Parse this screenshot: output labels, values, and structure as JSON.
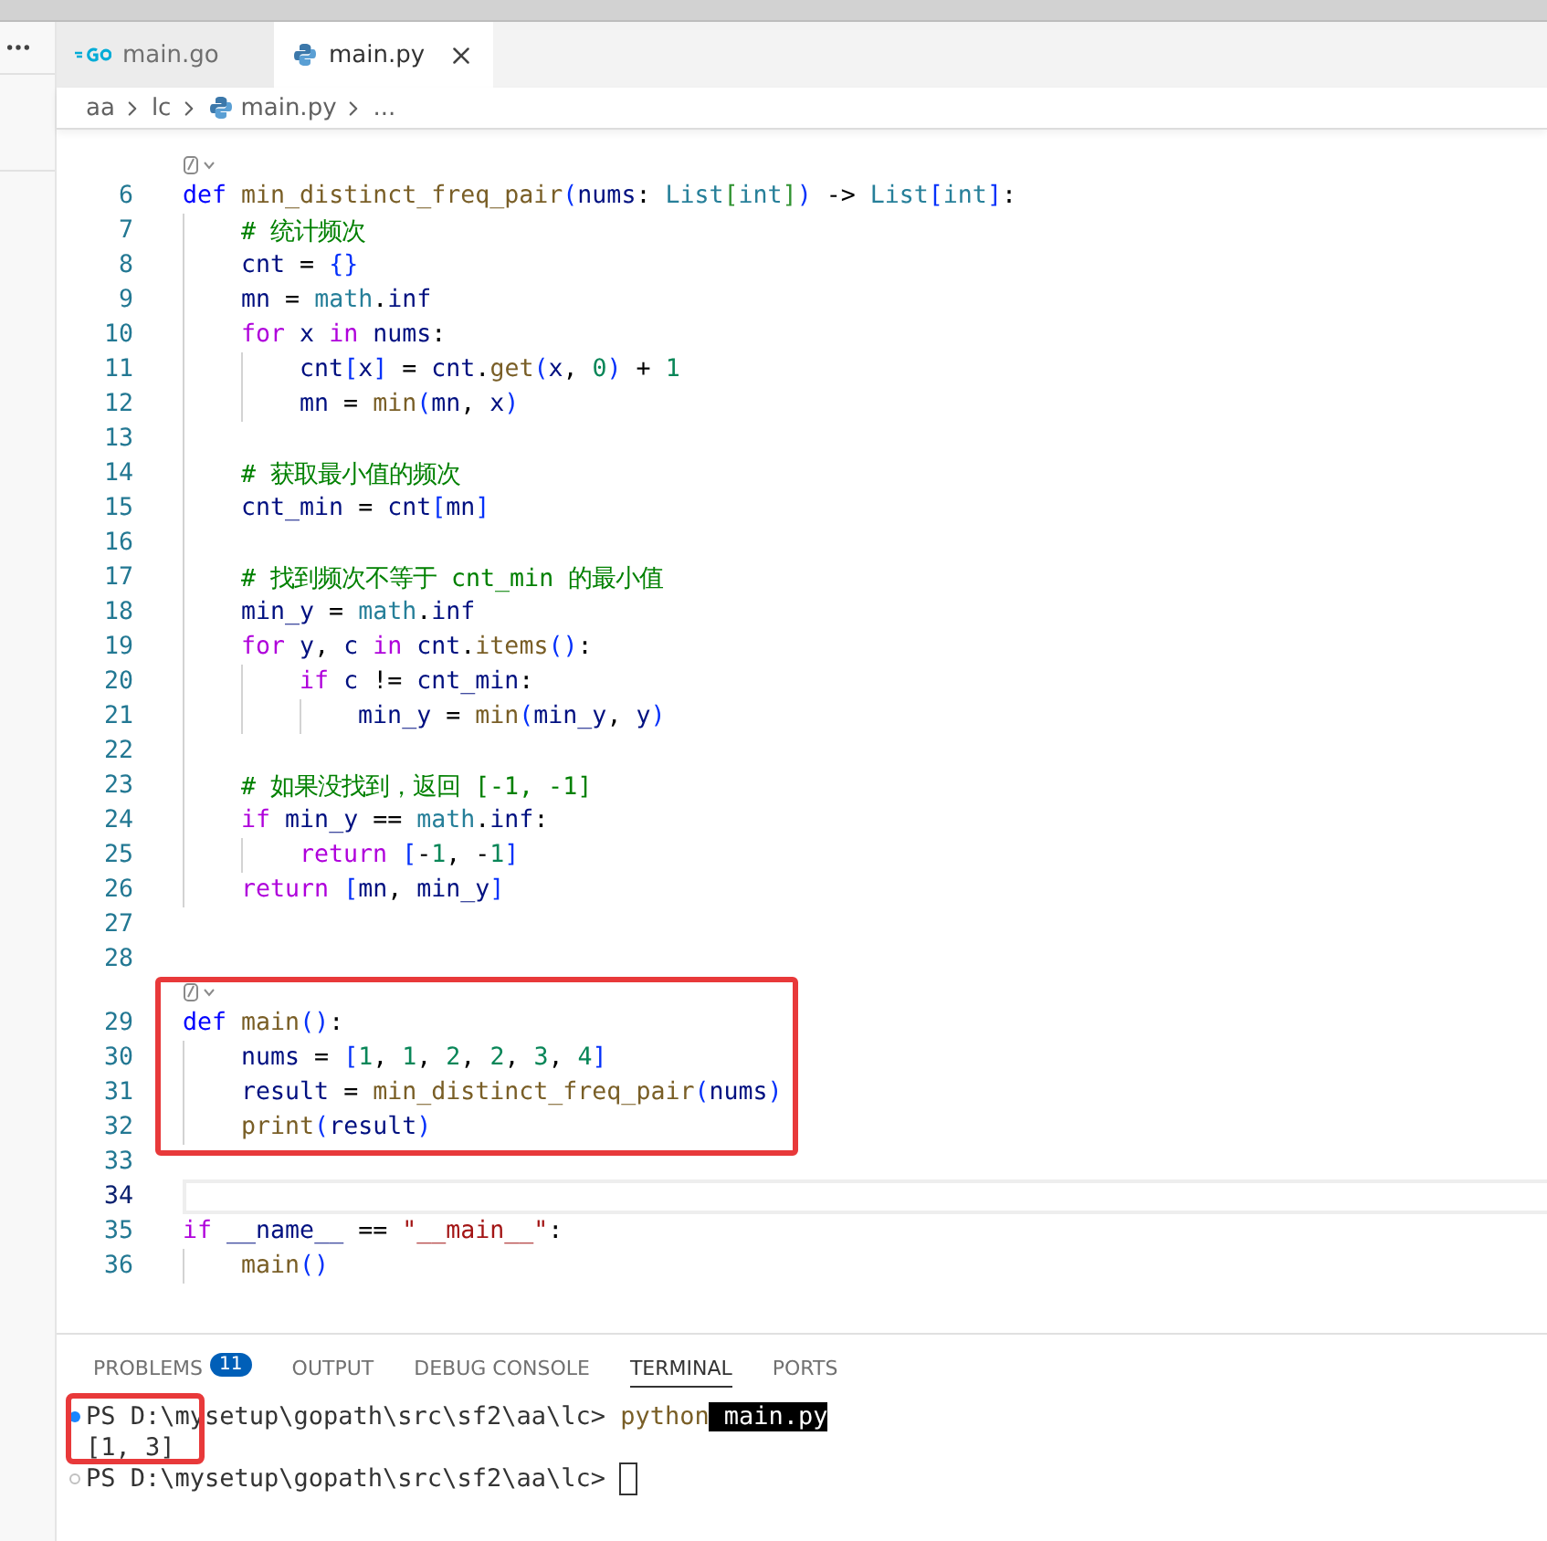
{
  "editor_tabs": [
    {
      "label": "main.go",
      "selected": false
    },
    {
      "label": "main.py",
      "selected": true
    }
  ],
  "breadcrumb": [
    "aa",
    "lc",
    "main.py",
    "..."
  ],
  "code": {
    "blocks": [
      {
        "marked": false,
        "lens": true,
        "lines": [
          {
            "number": "6",
            "tokens": [
              {
                "kind": "keyword",
                "text": "def "
              },
              {
                "kind": "function",
                "text": "min_distinct_freq_pair"
              },
              {
                "kind": "bracket",
                "text": "("
              },
              {
                "kind": "variable",
                "text": "nums"
              },
              {
                "kind": "punct",
                "text": ": "
              },
              {
                "kind": "type",
                "text": "List"
              },
              {
                "kind": "bracket2",
                "text": "["
              },
              {
                "kind": "type",
                "text": "int"
              },
              {
                "kind": "bracket2",
                "text": "]"
              },
              {
                "kind": "bracket",
                "text": ")"
              },
              {
                "kind": "punct",
                "text": " -> "
              },
              {
                "kind": "type",
                "text": "List"
              },
              {
                "kind": "bracket",
                "text": "["
              },
              {
                "kind": "type",
                "text": "int"
              },
              {
                "kind": "bracket",
                "text": "]"
              },
              {
                "kind": "punct",
                "text": ":"
              }
            ],
            "children": [
              {
                "number": "7",
                "tokens": [
                  {
                    "kind": "comment",
                    "text": "# 统计频次"
                  }
                ]
              },
              {
                "number": "8",
                "tokens": [
                  {
                    "kind": "variable",
                    "text": "cnt"
                  },
                  {
                    "kind": "punct",
                    "text": " = "
                  },
                  {
                    "kind": "bracket",
                    "text": "{}"
                  }
                ]
              },
              {
                "number": "9",
                "tokens": [
                  {
                    "kind": "variable",
                    "text": "mn"
                  },
                  {
                    "kind": "punct",
                    "text": " = "
                  },
                  {
                    "kind": "type",
                    "text": "math"
                  },
                  {
                    "kind": "punct",
                    "text": "."
                  },
                  {
                    "kind": "variable",
                    "text": "inf"
                  }
                ]
              },
              {
                "number": "10",
                "tokens": [
                  {
                    "kind": "control",
                    "text": "for "
                  },
                  {
                    "kind": "variable",
                    "text": "x "
                  },
                  {
                    "kind": "control",
                    "text": "in "
                  },
                  {
                    "kind": "variable",
                    "text": "nums"
                  },
                  {
                    "kind": "punct",
                    "text": ":"
                  }
                ],
                "children": [
                  {
                    "number": "11",
                    "tokens": [
                      {
                        "kind": "variable",
                        "text": "cnt"
                      },
                      {
                        "kind": "bracket",
                        "text": "["
                      },
                      {
                        "kind": "variable",
                        "text": "x"
                      },
                      {
                        "kind": "bracket",
                        "text": "]"
                      },
                      {
                        "kind": "punct",
                        "text": " = "
                      },
                      {
                        "kind": "variable",
                        "text": "cnt"
                      },
                      {
                        "kind": "punct",
                        "text": "."
                      },
                      {
                        "kind": "function",
                        "text": "get"
                      },
                      {
                        "kind": "bracket",
                        "text": "("
                      },
                      {
                        "kind": "variable",
                        "text": "x"
                      },
                      {
                        "kind": "punct",
                        "text": ", "
                      },
                      {
                        "kind": "number",
                        "text": "0"
                      },
                      {
                        "kind": "bracket",
                        "text": ")"
                      },
                      {
                        "kind": "punct",
                        "text": " + "
                      },
                      {
                        "kind": "number",
                        "text": "1"
                      }
                    ]
                  },
                  {
                    "number": "12",
                    "tokens": [
                      {
                        "kind": "variable",
                        "text": "mn"
                      },
                      {
                        "kind": "punct",
                        "text": " = "
                      },
                      {
                        "kind": "function",
                        "text": "min"
                      },
                      {
                        "kind": "bracket",
                        "text": "("
                      },
                      {
                        "kind": "variable",
                        "text": "mn"
                      },
                      {
                        "kind": "punct",
                        "text": ", "
                      },
                      {
                        "kind": "variable",
                        "text": "x"
                      },
                      {
                        "kind": "bracket",
                        "text": ")"
                      }
                    ]
                  }
                ]
              },
              {
                "number": "13"
              },
              {
                "number": "14",
                "tokens": [
                  {
                    "kind": "comment",
                    "text": "# 获取最小值的频次"
                  }
                ]
              },
              {
                "number": "15",
                "tokens": [
                  {
                    "kind": "variable",
                    "text": "cnt_min"
                  },
                  {
                    "kind": "punct",
                    "text": " = "
                  },
                  {
                    "kind": "variable",
                    "text": "cnt"
                  },
                  {
                    "kind": "bracket",
                    "text": "["
                  },
                  {
                    "kind": "variable",
                    "text": "mn"
                  },
                  {
                    "kind": "bracket",
                    "text": "]"
                  }
                ]
              },
              {
                "number": "16"
              },
              {
                "number": "17",
                "tokens": [
                  {
                    "kind": "comment",
                    "text": "# 找到频次不等于 cnt_min 的最小值"
                  }
                ]
              },
              {
                "number": "18",
                "tokens": [
                  {
                    "kind": "variable",
                    "text": "min_y"
                  },
                  {
                    "kind": "punct",
                    "text": " = "
                  },
                  {
                    "kind": "type",
                    "text": "math"
                  },
                  {
                    "kind": "punct",
                    "text": "."
                  },
                  {
                    "kind": "variable",
                    "text": "inf"
                  }
                ]
              },
              {
                "number": "19",
                "tokens": [
                  {
                    "kind": "control",
                    "text": "for "
                  },
                  {
                    "kind": "variable",
                    "text": "y"
                  },
                  {
                    "kind": "punct",
                    "text": ", "
                  },
                  {
                    "kind": "variable",
                    "text": "c "
                  },
                  {
                    "kind": "control",
                    "text": "in "
                  },
                  {
                    "kind": "variable",
                    "text": "cnt"
                  },
                  {
                    "kind": "punct",
                    "text": "."
                  },
                  {
                    "kind": "function",
                    "text": "items"
                  },
                  {
                    "kind": "bracket",
                    "text": "()"
                  },
                  {
                    "kind": "punct",
                    "text": ":"
                  }
                ],
                "children": [
                  {
                    "number": "20",
                    "tokens": [
                      {
                        "kind": "control",
                        "text": "if "
                      },
                      {
                        "kind": "variable",
                        "text": "c"
                      },
                      {
                        "kind": "punct",
                        "text": " != "
                      },
                      {
                        "kind": "variable",
                        "text": "cnt_min"
                      },
                      {
                        "kind": "punct",
                        "text": ":"
                      }
                    ],
                    "children": [
                      {
                        "number": "21",
                        "tokens": [
                          {
                            "kind": "variable",
                            "text": "min_y"
                          },
                          {
                            "kind": "punct",
                            "text": " = "
                          },
                          {
                            "kind": "function",
                            "text": "min"
                          },
                          {
                            "kind": "bracket",
                            "text": "("
                          },
                          {
                            "kind": "variable",
                            "text": "min_y"
                          },
                          {
                            "kind": "punct",
                            "text": ", "
                          },
                          {
                            "kind": "variable",
                            "text": "y"
                          },
                          {
                            "kind": "bracket",
                            "text": ")"
                          }
                        ]
                      }
                    ]
                  }
                ]
              },
              {
                "number": "22"
              },
              {
                "number": "23",
                "tokens": [
                  {
                    "kind": "comment",
                    "text": "# 如果没找到，返回 [-1, -1]"
                  }
                ]
              },
              {
                "number": "24",
                "tokens": [
                  {
                    "kind": "control",
                    "text": "if "
                  },
                  {
                    "kind": "variable",
                    "text": "min_y"
                  },
                  {
                    "kind": "punct",
                    "text": " == "
                  },
                  {
                    "kind": "type",
                    "text": "math"
                  },
                  {
                    "kind": "punct",
                    "text": "."
                  },
                  {
                    "kind": "variable",
                    "text": "inf"
                  },
                  {
                    "kind": "punct",
                    "text": ":"
                  }
                ],
                "children": [
                  {
                    "number": "25",
                    "tokens": [
                      {
                        "kind": "control",
                        "text": "return "
                      },
                      {
                        "kind": "bracket",
                        "text": "["
                      },
                      {
                        "kind": "punct",
                        "text": "-"
                      },
                      {
                        "kind": "number",
                        "text": "1"
                      },
                      {
                        "kind": "punct",
                        "text": ", -"
                      },
                      {
                        "kind": "number",
                        "text": "1"
                      },
                      {
                        "kind": "bracket",
                        "text": "]"
                      }
                    ]
                  }
                ]
              },
              {
                "number": "26",
                "tokens": [
                  {
                    "kind": "control",
                    "text": "return "
                  },
                  {
                    "kind": "bracket",
                    "text": "["
                  },
                  {
                    "kind": "variable",
                    "text": "mn"
                  },
                  {
                    "kind": "punct",
                    "text": ", "
                  },
                  {
                    "kind": "variable",
                    "text": "min_y"
                  },
                  {
                    "kind": "bracket",
                    "text": "]"
                  }
                ]
              }
            ]
          },
          {
            "number": "27"
          },
          {
            "number": "28"
          }
        ]
      },
      {
        "marked": true,
        "lens": true,
        "lines": [
          {
            "number": "29",
            "tokens": [
              {
                "kind": "keyword",
                "text": "def "
              },
              {
                "kind": "function",
                "text": "main"
              },
              {
                "kind": "bracket",
                "text": "()"
              },
              {
                "kind": "punct",
                "text": ":"
              }
            ],
            "children": [
              {
                "number": "30",
                "tokens": [
                  {
                    "kind": "variable",
                    "text": "nums"
                  },
                  {
                    "kind": "punct",
                    "text": " = "
                  },
                  {
                    "kind": "bracket",
                    "text": "["
                  },
                  {
                    "kind": "number",
                    "text": "1"
                  },
                  {
                    "kind": "punct",
                    "text": ", "
                  },
                  {
                    "kind": "number",
                    "text": "1"
                  },
                  {
                    "kind": "punct",
                    "text": ", "
                  },
                  {
                    "kind": "number",
                    "text": "2"
                  },
                  {
                    "kind": "punct",
                    "text": ", "
                  },
                  {
                    "kind": "number",
                    "text": "2"
                  },
                  {
                    "kind": "punct",
                    "text": ", "
                  },
                  {
                    "kind": "number",
                    "text": "3"
                  },
                  {
                    "kind": "punct",
                    "text": ", "
                  },
                  {
                    "kind": "number",
                    "text": "4"
                  },
                  {
                    "kind": "bracket",
                    "text": "]"
                  }
                ]
              },
              {
                "number": "31",
                "tokens": [
                  {
                    "kind": "variable",
                    "text": "result"
                  },
                  {
                    "kind": "punct",
                    "text": " = "
                  },
                  {
                    "kind": "function",
                    "text": "min_distinct_freq_pair"
                  },
                  {
                    "kind": "bracket",
                    "text": "("
                  },
                  {
                    "kind": "variable",
                    "text": "nums"
                  },
                  {
                    "kind": "bracket",
                    "text": ")"
                  }
                ]
              },
              {
                "number": "32",
                "tokens": [
                  {
                    "kind": "function",
                    "text": "print"
                  },
                  {
                    "kind": "bracket",
                    "text": "("
                  },
                  {
                    "kind": "variable",
                    "text": "result"
                  },
                  {
                    "kind": "bracket",
                    "text": ")"
                  }
                ]
              }
            ]
          },
          {
            "number": "33"
          }
        ]
      },
      {
        "marked": false,
        "lens": false,
        "lines": [
          {
            "number": "34",
            "current": true
          },
          {
            "number": "35",
            "tokens": [
              {
                "kind": "control",
                "text": "if "
              },
              {
                "kind": "variable",
                "text": "__name__"
              },
              {
                "kind": "punct",
                "text": " == "
              },
              {
                "kind": "string",
                "text": "\"__main__\""
              },
              {
                "kind": "punct",
                "text": ":"
              }
            ],
            "children": [
              {
                "number": "36",
                "tokens": [
                  {
                    "kind": "function",
                    "text": "main"
                  },
                  {
                    "kind": "bracket",
                    "text": "()"
                  }
                ]
              }
            ]
          }
        ]
      }
    ]
  },
  "panel_tabs": [
    {
      "label": "PROBLEMS",
      "badge": "11",
      "selected": false
    },
    {
      "label": "OUTPUT",
      "selected": false
    },
    {
      "label": "DEBUG CONSOLE",
      "selected": false
    },
    {
      "label": "TERMINAL",
      "selected": true
    },
    {
      "label": "PORTS",
      "selected": false
    }
  ],
  "terminal": {
    "marked": true,
    "lines": [
      {
        "kind": "prompt",
        "succeeded": true,
        "prompt": "PS D:\\mysetup\\gopath\\src\\sf2\\aa\\lc>",
        "command": "python",
        "argument": "main.py"
      },
      {
        "kind": "output",
        "text": "[1, 3]"
      },
      {
        "kind": "prompt",
        "succeeded": false,
        "prompt": "PS D:\\mysetup\\gopath\\src\\sf2\\aa\\lc>",
        "cursor": true
      }
    ]
  }
}
